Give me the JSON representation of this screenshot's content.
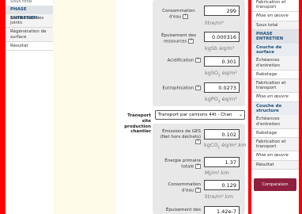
{
  "left_nav": {
    "cut_label": "Sous total",
    "section_title": "PHASE ENTRETIEN",
    "items": [
      "Scellement des joints",
      "Régénération de surface",
      "Résultat"
    ]
  },
  "form": {
    "top": {
      "water_label": "Consommation d'eau",
      "water_value": "299",
      "water_unit": "litre/m³",
      "resources_label": "Épuisement des ressources",
      "resources_value": "0.000316",
      "resources_unit": "kgSb éq/m²",
      "acid_label": "Acidification",
      "acid_value": "0.301",
      "acid_unit_base": "kgSO",
      "acid_unit_sub": "2",
      "acid_unit_rest": " éq/m²",
      "eutro_label": "Eutrophisation",
      "eutro_value": "0.0273",
      "eutro_unit_base": "kgPO",
      "eutro_unit_sub": "4",
      "eutro_unit_rest": " éq/m²"
    },
    "transport": {
      "label": "Transport site production chantier",
      "selected": "Transport par camions 44t - Chan",
      "ghg_label": "Émissions de GES (Net hors déchets)",
      "ghg_value": "0.102",
      "ghg_unit_base": "kgCO",
      "ghg_unit_sub": "2",
      "ghg_unit_rest": " éq/m².km",
      "energy_label": "Énergie primaire totale",
      "energy_value": "1.37",
      "energy_unit": "MJ/m².km",
      "water_label": "Consommation d'eau",
      "water_value": "0.129",
      "water_unit": "litre/m².km",
      "resources_label": "Épuisement des",
      "resources_value": "1.42e-7"
    },
    "help_glyph": "?"
  },
  "right_nav": {
    "items_top": [
      "Fabrication et transport",
      "Mise en œuvre",
      "Sous total"
    ],
    "phase_title": "PHASE ENTRETIEN",
    "surface_title": "Couche de surface",
    "surface_items": [
      "Échéances d'entretien",
      "Rabotage",
      "Fabrication et transport",
      "Mise en œuvre"
    ],
    "structure_title": "Couche de structure",
    "structure_items": [
      "Échéances d'entretien",
      "Rabotage",
      "Fabrication et transport",
      "Mise en œuvre",
      "Résultat"
    ],
    "compare_label": "Comparaison"
  }
}
